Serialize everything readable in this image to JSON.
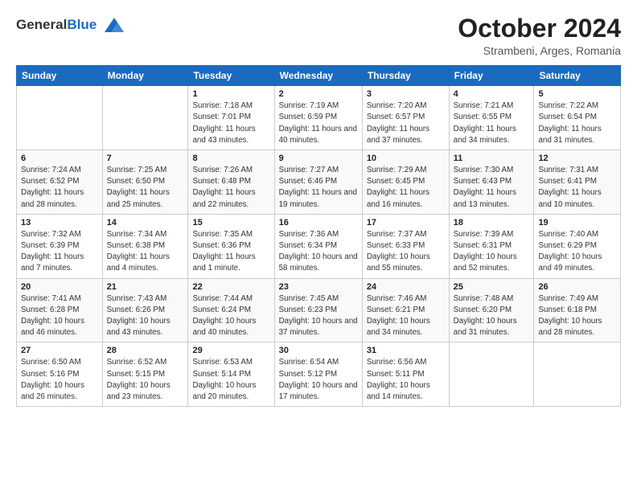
{
  "header": {
    "logo_line1": "General",
    "logo_line2": "Blue",
    "month": "October 2024",
    "location": "Strambeni, Arges, Romania"
  },
  "weekdays": [
    "Sunday",
    "Monday",
    "Tuesday",
    "Wednesday",
    "Thursday",
    "Friday",
    "Saturday"
  ],
  "weeks": [
    [
      {
        "day": "",
        "sunrise": "",
        "sunset": "",
        "daylight": ""
      },
      {
        "day": "",
        "sunrise": "",
        "sunset": "",
        "daylight": ""
      },
      {
        "day": "1",
        "sunrise": "Sunrise: 7:18 AM",
        "sunset": "Sunset: 7:01 PM",
        "daylight": "Daylight: 11 hours and 43 minutes."
      },
      {
        "day": "2",
        "sunrise": "Sunrise: 7:19 AM",
        "sunset": "Sunset: 6:59 PM",
        "daylight": "Daylight: 11 hours and 40 minutes."
      },
      {
        "day": "3",
        "sunrise": "Sunrise: 7:20 AM",
        "sunset": "Sunset: 6:57 PM",
        "daylight": "Daylight: 11 hours and 37 minutes."
      },
      {
        "day": "4",
        "sunrise": "Sunrise: 7:21 AM",
        "sunset": "Sunset: 6:55 PM",
        "daylight": "Daylight: 11 hours and 34 minutes."
      },
      {
        "day": "5",
        "sunrise": "Sunrise: 7:22 AM",
        "sunset": "Sunset: 6:54 PM",
        "daylight": "Daylight: 11 hours and 31 minutes."
      }
    ],
    [
      {
        "day": "6",
        "sunrise": "Sunrise: 7:24 AM",
        "sunset": "Sunset: 6:52 PM",
        "daylight": "Daylight: 11 hours and 28 minutes."
      },
      {
        "day": "7",
        "sunrise": "Sunrise: 7:25 AM",
        "sunset": "Sunset: 6:50 PM",
        "daylight": "Daylight: 11 hours and 25 minutes."
      },
      {
        "day": "8",
        "sunrise": "Sunrise: 7:26 AM",
        "sunset": "Sunset: 6:48 PM",
        "daylight": "Daylight: 11 hours and 22 minutes."
      },
      {
        "day": "9",
        "sunrise": "Sunrise: 7:27 AM",
        "sunset": "Sunset: 6:46 PM",
        "daylight": "Daylight: 11 hours and 19 minutes."
      },
      {
        "day": "10",
        "sunrise": "Sunrise: 7:29 AM",
        "sunset": "Sunset: 6:45 PM",
        "daylight": "Daylight: 11 hours and 16 minutes."
      },
      {
        "day": "11",
        "sunrise": "Sunrise: 7:30 AM",
        "sunset": "Sunset: 6:43 PM",
        "daylight": "Daylight: 11 hours and 13 minutes."
      },
      {
        "day": "12",
        "sunrise": "Sunrise: 7:31 AM",
        "sunset": "Sunset: 6:41 PM",
        "daylight": "Daylight: 11 hours and 10 minutes."
      }
    ],
    [
      {
        "day": "13",
        "sunrise": "Sunrise: 7:32 AM",
        "sunset": "Sunset: 6:39 PM",
        "daylight": "Daylight: 11 hours and 7 minutes."
      },
      {
        "day": "14",
        "sunrise": "Sunrise: 7:34 AM",
        "sunset": "Sunset: 6:38 PM",
        "daylight": "Daylight: 11 hours and 4 minutes."
      },
      {
        "day": "15",
        "sunrise": "Sunrise: 7:35 AM",
        "sunset": "Sunset: 6:36 PM",
        "daylight": "Daylight: 11 hours and 1 minute."
      },
      {
        "day": "16",
        "sunrise": "Sunrise: 7:36 AM",
        "sunset": "Sunset: 6:34 PM",
        "daylight": "Daylight: 10 hours and 58 minutes."
      },
      {
        "day": "17",
        "sunrise": "Sunrise: 7:37 AM",
        "sunset": "Sunset: 6:33 PM",
        "daylight": "Daylight: 10 hours and 55 minutes."
      },
      {
        "day": "18",
        "sunrise": "Sunrise: 7:39 AM",
        "sunset": "Sunset: 6:31 PM",
        "daylight": "Daylight: 10 hours and 52 minutes."
      },
      {
        "day": "19",
        "sunrise": "Sunrise: 7:40 AM",
        "sunset": "Sunset: 6:29 PM",
        "daylight": "Daylight: 10 hours and 49 minutes."
      }
    ],
    [
      {
        "day": "20",
        "sunrise": "Sunrise: 7:41 AM",
        "sunset": "Sunset: 6:28 PM",
        "daylight": "Daylight: 10 hours and 46 minutes."
      },
      {
        "day": "21",
        "sunrise": "Sunrise: 7:43 AM",
        "sunset": "Sunset: 6:26 PM",
        "daylight": "Daylight: 10 hours and 43 minutes."
      },
      {
        "day": "22",
        "sunrise": "Sunrise: 7:44 AM",
        "sunset": "Sunset: 6:24 PM",
        "daylight": "Daylight: 10 hours and 40 minutes."
      },
      {
        "day": "23",
        "sunrise": "Sunrise: 7:45 AM",
        "sunset": "Sunset: 6:23 PM",
        "daylight": "Daylight: 10 hours and 37 minutes."
      },
      {
        "day": "24",
        "sunrise": "Sunrise: 7:46 AM",
        "sunset": "Sunset: 6:21 PM",
        "daylight": "Daylight: 10 hours and 34 minutes."
      },
      {
        "day": "25",
        "sunrise": "Sunrise: 7:48 AM",
        "sunset": "Sunset: 6:20 PM",
        "daylight": "Daylight: 10 hours and 31 minutes."
      },
      {
        "day": "26",
        "sunrise": "Sunrise: 7:49 AM",
        "sunset": "Sunset: 6:18 PM",
        "daylight": "Daylight: 10 hours and 28 minutes."
      }
    ],
    [
      {
        "day": "27",
        "sunrise": "Sunrise: 6:50 AM",
        "sunset": "Sunset: 5:16 PM",
        "daylight": "Daylight: 10 hours and 26 minutes."
      },
      {
        "day": "28",
        "sunrise": "Sunrise: 6:52 AM",
        "sunset": "Sunset: 5:15 PM",
        "daylight": "Daylight: 10 hours and 23 minutes."
      },
      {
        "day": "29",
        "sunrise": "Sunrise: 6:53 AM",
        "sunset": "Sunset: 5:14 PM",
        "daylight": "Daylight: 10 hours and 20 minutes."
      },
      {
        "day": "30",
        "sunrise": "Sunrise: 6:54 AM",
        "sunset": "Sunset: 5:12 PM",
        "daylight": "Daylight: 10 hours and 17 minutes."
      },
      {
        "day": "31",
        "sunrise": "Sunrise: 6:56 AM",
        "sunset": "Sunset: 5:11 PM",
        "daylight": "Daylight: 10 hours and 14 minutes."
      },
      {
        "day": "",
        "sunrise": "",
        "sunset": "",
        "daylight": ""
      },
      {
        "day": "",
        "sunrise": "",
        "sunset": "",
        "daylight": ""
      }
    ]
  ]
}
